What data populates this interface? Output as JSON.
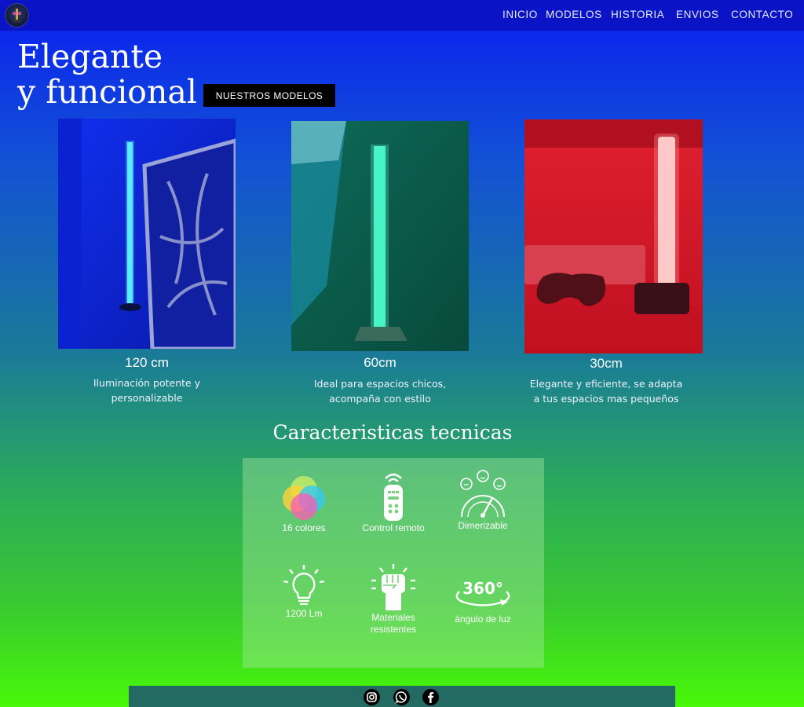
{
  "nav": {
    "items": [
      {
        "label": "INICIO"
      },
      {
        "label": "MODELOS"
      },
      {
        "label": "HISTORIA"
      },
      {
        "label": "ENVIOS"
      },
      {
        "label": "CONTACTO"
      }
    ]
  },
  "hero": {
    "title_line1": "Elegante",
    "title_line2": "y funcional",
    "cta_label": "NUESTROS MODELOS"
  },
  "models": [
    {
      "name": "120 cm",
      "description": "Iluminación potente y\npersonalizable"
    },
    {
      "name": "60cm",
      "description": "Ideal para espacios chicos,\nacompaña con estilo"
    },
    {
      "name": "30cm",
      "description": "Elegante y eficiente, se adapta\na tus espacios mas pequeños"
    }
  ],
  "features": {
    "title": "Caracteristicas tecnicas",
    "items": [
      {
        "label": "16 colores",
        "icon": "color-circles-icon"
      },
      {
        "label": "Control remoto",
        "icon": "remote-control-icon"
      },
      {
        "label": "Dimerizable",
        "icon": "dimmer-gauge-icon"
      },
      {
        "label": "1200 Lm",
        "icon": "light-bulb-icon"
      },
      {
        "label": "Materiales\nresistentes",
        "icon": "strong-fist-icon"
      },
      {
        "label": "ángulo de luz",
        "icon": "rotation-360-icon",
        "badge": "360°"
      }
    ]
  },
  "footer": {
    "social": [
      {
        "icon": "instagram-icon"
      },
      {
        "icon": "whatsapp-icon"
      },
      {
        "icon": "facebook-icon"
      }
    ]
  },
  "colors": {
    "topbar": "#0a14c6",
    "gradient_top": "#0a1ef0",
    "gradient_bottom": "#48f808",
    "footer": "#236b62",
    "cta": "#000000"
  }
}
